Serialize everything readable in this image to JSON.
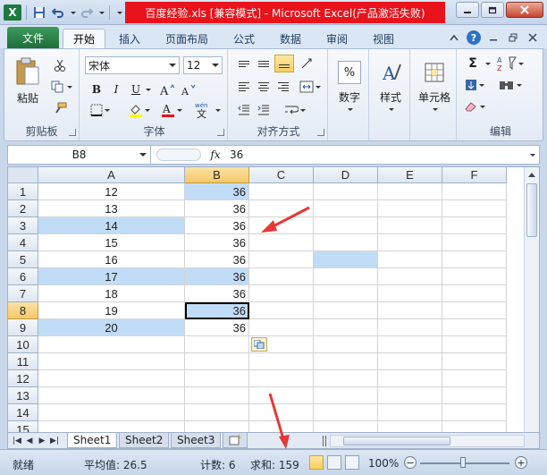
{
  "window": {
    "title": "百度经验.xls  [兼容模式] - Microsoft Excel(产品激活失败)"
  },
  "ribbon_tabs": [
    "文件",
    "开始",
    "插入",
    "页面布局",
    "公式",
    "数据",
    "审阅",
    "视图"
  ],
  "ribbon": {
    "clipboard": {
      "paste": "粘贴",
      "label": "剪贴板"
    },
    "font": {
      "name": "宋体",
      "size": "12",
      "label": "字体",
      "bold": "B",
      "italic": "I",
      "underline": "U"
    },
    "alignment": {
      "label": "对齐方式"
    },
    "number": {
      "format_btn": "数字",
      "percent": "%"
    },
    "styles": {
      "btn": "样式"
    },
    "cells": {
      "btn": "单元格"
    },
    "editing": {
      "label": "编辑",
      "sum": "Σ"
    }
  },
  "formula_bar": {
    "name_box": "B8",
    "fx": "fx",
    "content": "36"
  },
  "grid": {
    "columns": [
      "A",
      "B",
      "C",
      "D",
      "E",
      "F"
    ],
    "rows": [
      "1",
      "2",
      "3",
      "4",
      "5",
      "6",
      "7",
      "8",
      "9",
      "10",
      "11",
      "12",
      "13",
      "14",
      "15"
    ],
    "col_a": [
      "12",
      "13",
      "14",
      "15",
      "16",
      "17",
      "18",
      "19",
      "20"
    ],
    "col_b": [
      "36",
      "36",
      "36",
      "36",
      "36",
      "36",
      "36",
      "36",
      "36"
    ]
  },
  "sheets": [
    "Sheet1",
    "Sheet2",
    "Sheet3"
  ],
  "status": {
    "ready": "就绪",
    "average": "平均值: 26.5",
    "count": "计数: 6",
    "sum": "求和: 159",
    "zoom": "100%"
  },
  "colors": {
    "highlight": "#c1dcf6",
    "file_tab": "#217346",
    "title_bg": "#e8131b",
    "annotation": "#e53935"
  }
}
